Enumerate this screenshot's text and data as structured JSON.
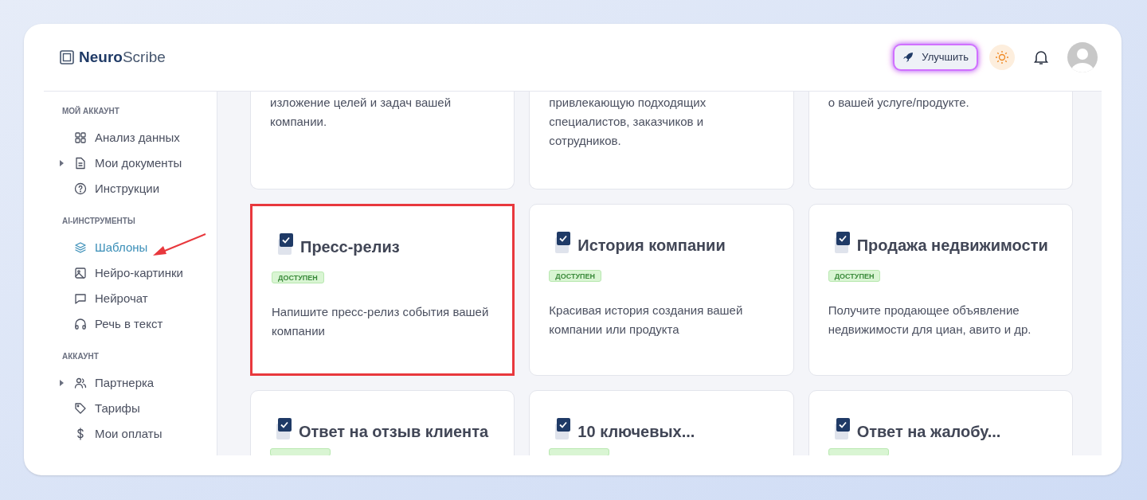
{
  "logo": {
    "bold": "Neuro",
    "regular": "Scribe"
  },
  "header": {
    "upgrade_button": "Улучшить"
  },
  "sidebar": {
    "sections": [
      {
        "title": "МОЙ АККАУНТ",
        "items": [
          {
            "label": "Анализ данных",
            "expandable": false,
            "selected": false
          },
          {
            "label": "Мои документы",
            "expandable": true,
            "selected": false
          },
          {
            "label": "Инструкции",
            "expandable": false,
            "selected": false
          }
        ]
      },
      {
        "title": "AI-ИНСТРУМЕНТЫ",
        "items": [
          {
            "label": "Шаблоны",
            "expandable": false,
            "selected": true
          },
          {
            "label": "Нейро-картинки",
            "expandable": false,
            "selected": false
          },
          {
            "label": "Нейрочат",
            "expandable": false,
            "selected": false
          },
          {
            "label": "Речь в текст",
            "expandable": false,
            "selected": false
          }
        ]
      },
      {
        "title": "АККАУНТ",
        "items": [
          {
            "label": "Партнерка",
            "expandable": true,
            "selected": false
          },
          {
            "label": "Тарифы",
            "expandable": false,
            "selected": false
          },
          {
            "label": "Мои оплаты",
            "expandable": false,
            "selected": false
          }
        ]
      }
    ]
  },
  "annotation": {
    "kind": "arrow"
  },
  "cards": [
    {
      "kind": "cut_top",
      "description": "изложение целей и задач вашей компании.",
      "highlighted": false
    },
    {
      "kind": "cut_top",
      "description": "привлекающую подходящих специалистов, заказчиков и сотрудников.",
      "highlighted": false
    },
    {
      "kind": "cut_top",
      "description": "о вашей услуге/продукте.",
      "highlighted": false
    },
    {
      "kind": "full",
      "title": "Пресс-релиз",
      "badge": "ДОСТУПЕН",
      "description": "Напишите пресс-релиз события вашей компании",
      "highlighted": true
    },
    {
      "kind": "full",
      "title": "История компании",
      "badge": "ДОСТУПЕН",
      "description": "Красивая история создания вашей компании или продукта",
      "highlighted": false
    },
    {
      "kind": "full",
      "title": "Продажа недвижимости",
      "badge": "ДОСТУПЕН",
      "description": "Получите продающее объявление недвижимости для циан, авито и др.",
      "highlighted": false
    },
    {
      "kind": "cut_bottom",
      "title": "Ответ на отзыв клиента",
      "highlighted": false
    },
    {
      "kind": "cut_bottom",
      "title": "10 ключевых...",
      "highlighted": false
    },
    {
      "kind": "cut_bottom",
      "title": "Ответ на жалобу...",
      "highlighted": false
    }
  ]
}
